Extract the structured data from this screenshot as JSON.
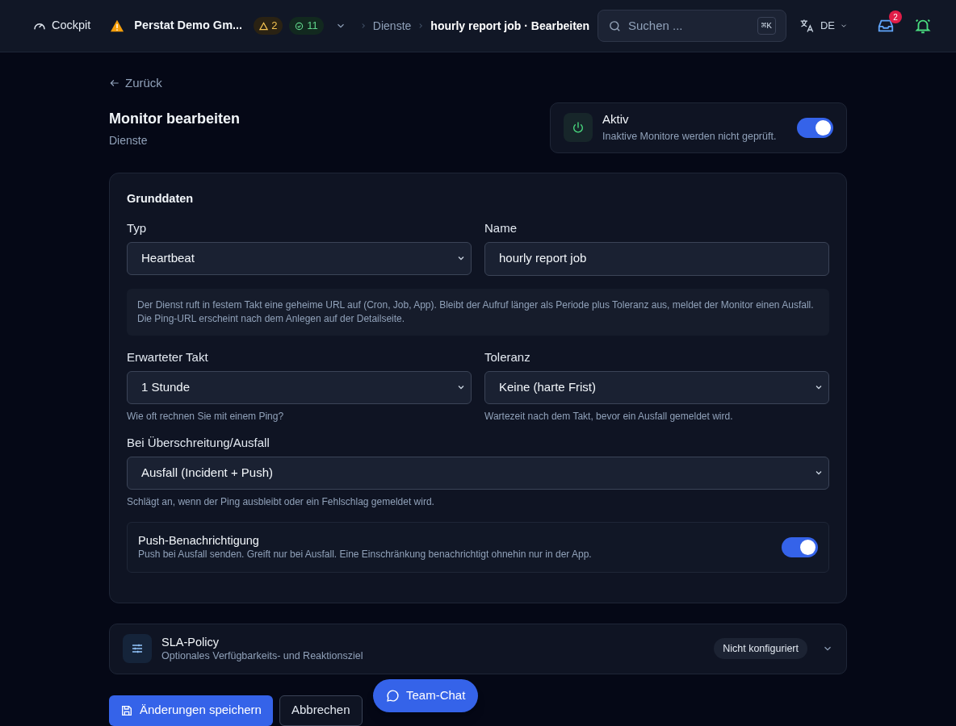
{
  "header": {
    "home": "Cockpit",
    "org": "Perstat Demo Gm...",
    "warnings": "2",
    "ok": "11",
    "breadcrumb": [
      "Dienste",
      "hourly report job · Bearbeiten"
    ],
    "search": {
      "placeholder": "Suchen ...",
      "shortcut": "⌘K"
    },
    "language": "DE",
    "inbox_count": "2"
  },
  "back": "Zurück",
  "title": "Monitor bearbeiten",
  "subtitle": "Dienste",
  "active": {
    "label": "Aktiv",
    "hint": "Inaktive Monitore werden nicht geprüft.",
    "on": true
  },
  "section": {
    "title": "Grunddaten",
    "type": {
      "label": "Typ",
      "value": "Heartbeat"
    },
    "name": {
      "label": "Name",
      "value": "hourly report job"
    },
    "info": "Der Dienst ruft in festem Takt eine geheime URL auf (Cron, Job, App). Bleibt der Aufruf länger als Periode plus Toleranz aus, meldet der Monitor einen Ausfall. Die Ping-URL erscheint nach dem Anlegen auf der Detailseite.",
    "interval": {
      "label": "Erwarteter Takt",
      "value": "1 Stunde",
      "help": "Wie oft rechnen Sie mit einem Ping?"
    },
    "tolerance": {
      "label": "Toleranz",
      "value": "Keine (harte Frist)",
      "help": "Wartezeit nach dem Takt, bevor ein Ausfall gemeldet wird."
    },
    "on_failure": {
      "label": "Bei Überschreitung/Ausfall",
      "value": "Ausfall (Incident + Push)",
      "help": "Schlägt an, wenn der Ping ausbleibt oder ein Fehlschlag gemeldet wird."
    },
    "push": {
      "label": "Push-Benachrichtigung",
      "hint": "Push bei Ausfall senden. Greift nur bei Ausfall. Eine Einschränkung benachrichtigt ohnehin nur in der App.",
      "on": true
    }
  },
  "sla": {
    "title": "SLA-Policy",
    "subtitle": "Optionales Verfügbarkeits- und Reaktionsziel",
    "status": "Nicht konfiguriert",
    "expanded": false
  },
  "buttons": {
    "save": "Änderungen speichern",
    "cancel": "Abbrechen"
  },
  "chat": "Team-Chat"
}
